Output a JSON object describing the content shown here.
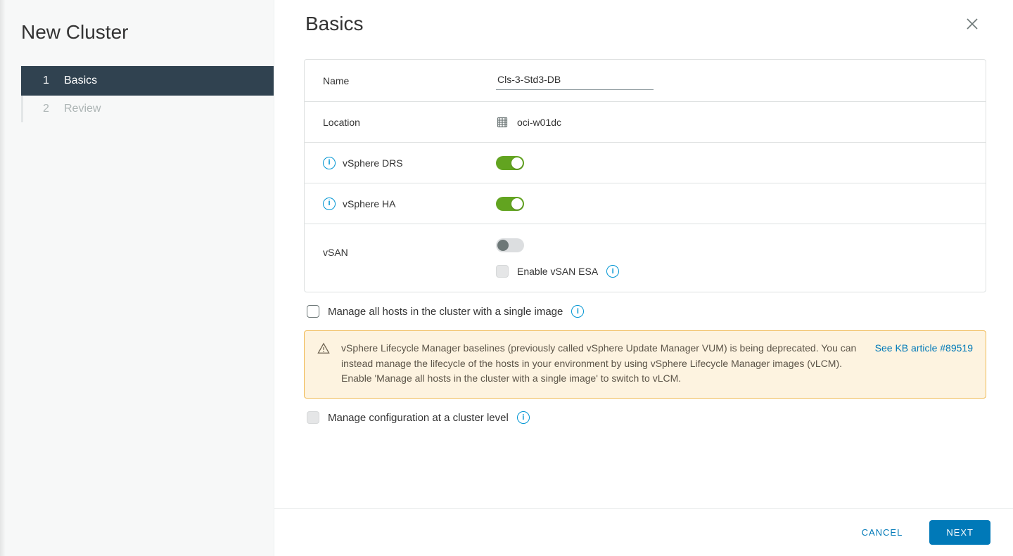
{
  "sidebar": {
    "title": "New Cluster",
    "steps": [
      {
        "num": "1",
        "label": "Basics",
        "state": "active"
      },
      {
        "num": "2",
        "label": "Review",
        "state": "pending"
      }
    ]
  },
  "header": {
    "title": "Basics"
  },
  "form": {
    "name": {
      "label": "Name",
      "value": "Cls-3-Std3-DB"
    },
    "location": {
      "label": "Location",
      "value": "oci-w01dc"
    },
    "drs": {
      "label": "vSphere DRS",
      "on": true
    },
    "ha": {
      "label": "vSphere HA",
      "on": true
    },
    "vsan": {
      "label": "vSAN",
      "on": false,
      "esa_label": "Enable vSAN ESA"
    },
    "single_image": {
      "label": "Manage all hosts in the cluster with a single image",
      "checked": false
    },
    "warning": {
      "message": "vSphere Lifecycle Manager baselines (previously called vSphere Update Manager VUM) is being deprecated. You can instead manage the lifecycle of the hosts in your environment by using vSphere Lifecycle Manager images (vLCM). Enable 'Manage all hosts in the cluster with a single image' to switch to vLCM.",
      "link": "See KB article #89519"
    },
    "cluster_config": {
      "label": "Manage configuration at a cluster level",
      "enabled": false
    }
  },
  "footer": {
    "cancel": "CANCEL",
    "next": "NEXT"
  }
}
